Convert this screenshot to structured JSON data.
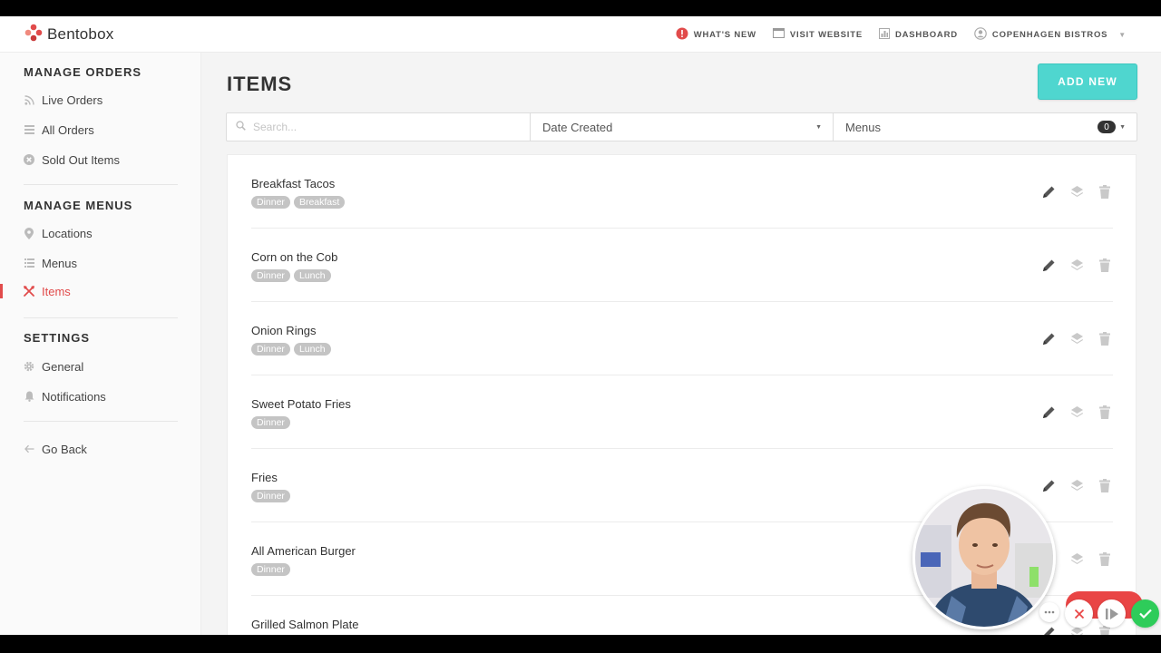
{
  "brand": {
    "name": "Bentobox",
    "accent": "#e14b4b"
  },
  "topnav": [
    {
      "label": "WHAT'S NEW",
      "icon": "alert-icon"
    },
    {
      "label": "VISIT WEBSITE",
      "icon": "browser-icon"
    },
    {
      "label": "DASHBOARD",
      "icon": "bar-chart-icon"
    },
    {
      "label": "COPENHAGEN BISTROS",
      "icon": "user-icon"
    }
  ],
  "sidebar": {
    "sections": [
      {
        "title": "MANAGE ORDERS",
        "items": [
          {
            "label": "Live Orders",
            "icon": "rss-icon"
          },
          {
            "label": "All Orders",
            "icon": "list-icon"
          },
          {
            "label": "Sold Out Items",
            "icon": "x-circle-icon"
          }
        ]
      },
      {
        "title": "MANAGE MENUS",
        "items": [
          {
            "label": "Locations",
            "icon": "pin-icon"
          },
          {
            "label": "Menus",
            "icon": "list-icon"
          },
          {
            "label": "Items",
            "icon": "utensils-icon",
            "active": true
          }
        ]
      },
      {
        "title": "SETTINGS",
        "items": [
          {
            "label": "General",
            "icon": "gear-icon"
          },
          {
            "label": "Notifications",
            "icon": "bell-icon"
          }
        ]
      }
    ],
    "back": {
      "label": "Go Back",
      "icon": "arrow-left-icon"
    }
  },
  "main": {
    "title": "ITEMS",
    "add_label": "ADD NEW",
    "search_placeholder": "Search...",
    "sort_value": "Date Created",
    "menus_label": "Menus",
    "menus_count": "0"
  },
  "items": [
    {
      "name": "Breakfast Tacos",
      "tags": [
        "Dinner",
        "Breakfast"
      ]
    },
    {
      "name": "Corn on the Cob",
      "tags": [
        "Dinner",
        "Lunch"
      ]
    },
    {
      "name": "Onion Rings",
      "tags": [
        "Dinner",
        "Lunch"
      ]
    },
    {
      "name": "Sweet Potato Fries",
      "tags": [
        "Dinner"
      ]
    },
    {
      "name": "Fries",
      "tags": [
        "Dinner"
      ]
    },
    {
      "name": "All American Burger",
      "tags": [
        "Dinner"
      ]
    },
    {
      "name": "Grilled Salmon Plate",
      "tags": []
    }
  ],
  "recorder": {
    "controls": [
      {
        "icon": "more-icon"
      },
      {
        "icon": "close-icon"
      },
      {
        "icon": "pause-resume-icon"
      },
      {
        "icon": "check-icon"
      }
    ]
  }
}
